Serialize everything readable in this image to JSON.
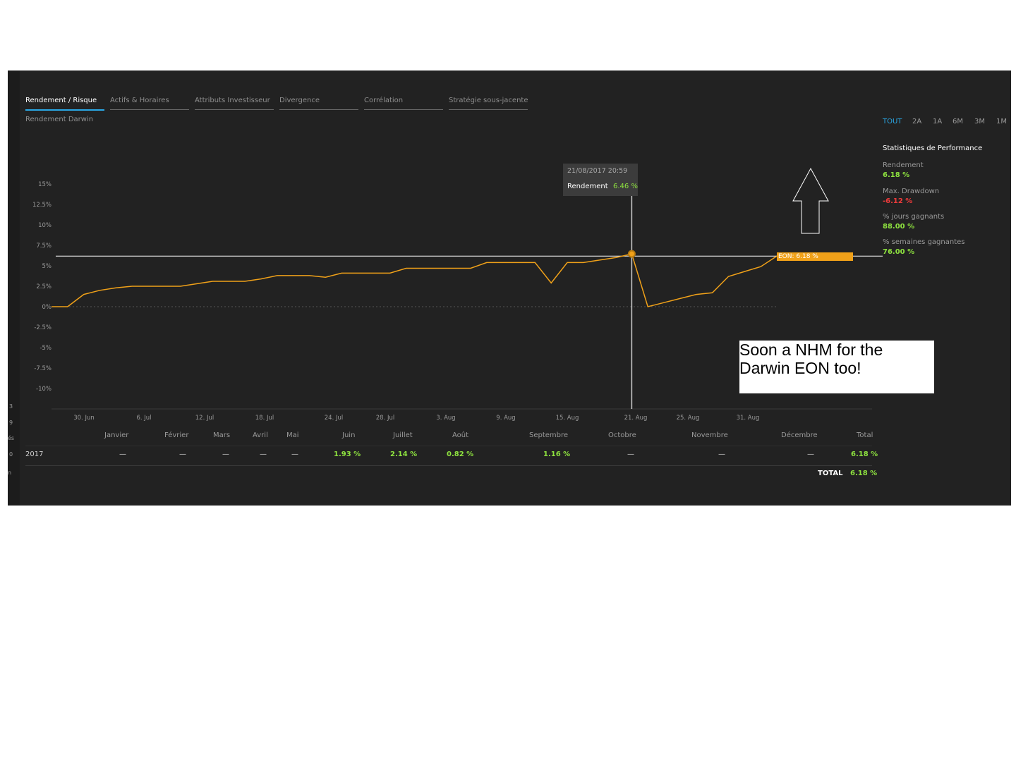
{
  "left_strip": [
    "3",
    "9",
    "és",
    "0",
    "n"
  ],
  "tabs": [
    {
      "label": "Rendement / Risque",
      "active": true
    },
    {
      "label": "Actifs & Horaires",
      "active": false
    },
    {
      "label": "Attributs Investisseur",
      "active": false
    },
    {
      "label": "Divergence",
      "active": false
    },
    {
      "label": "Corrélation",
      "active": false
    },
    {
      "label": "Stratégie sous-jacente",
      "active": false
    }
  ],
  "subtitle": "Rendement Darwin",
  "ranges": [
    {
      "label": "TOUT",
      "active": true
    },
    {
      "label": "2A",
      "active": false
    },
    {
      "label": "1A",
      "active": false
    },
    {
      "label": "6M",
      "active": false
    },
    {
      "label": "3M",
      "active": false
    },
    {
      "label": "1M",
      "active": false
    }
  ],
  "stats": {
    "title": "Statistiques de Performance",
    "items": [
      {
        "label": "Rendement",
        "value": "6.18 %",
        "tone": "green"
      },
      {
        "label": "Max. Drawdown",
        "value": "-6.12 %",
        "tone": "red"
      },
      {
        "label": "% jours gagnants",
        "value": "88.00 %",
        "tone": "green"
      },
      {
        "label": "% semaines gagnantes",
        "value": "76.00 %",
        "tone": "green"
      }
    ]
  },
  "tooltip": {
    "datetime": "21/08/2017 20:59",
    "label": "Rendement",
    "value": "6.46 %"
  },
  "eon_tag": "EON: 6.18 %",
  "colors": {
    "line": "#f0a119",
    "accent": "#2aa8e6",
    "positive": "#8ee23f",
    "negative": "#ef3b3b"
  },
  "chart_data": {
    "type": "line",
    "series": [
      {
        "name": "EON",
        "values": [
          0,
          0,
          1.5,
          2.0,
          2.3,
          2.5,
          2.5,
          2.5,
          2.5,
          2.8,
          3.1,
          3.1,
          3.1,
          3.4,
          3.8,
          3.8,
          3.8,
          3.6,
          4.1,
          4.1,
          4.1,
          4.1,
          4.7,
          4.7,
          4.7,
          4.7,
          4.7,
          5.4,
          5.4,
          5.4,
          5.4,
          2.9,
          5.4,
          5.4,
          5.7,
          6.0,
          6.46,
          0.0,
          0.5,
          1.0,
          1.5,
          1.7,
          3.7,
          4.3,
          4.9,
          6.18
        ]
      }
    ],
    "ylim": [
      -11,
      16
    ],
    "yticks": [
      "15%",
      "12.5%",
      "10%",
      "7.5%",
      "5%",
      "2.5%",
      "0%",
      "-2.5%",
      "-5%",
      "-7.5%",
      "-10%"
    ],
    "ytick_values": [
      15,
      12.5,
      10,
      7.5,
      5,
      2.5,
      0,
      -2.5,
      -5,
      -7.5,
      -10
    ],
    "xticks": [
      "30. Jun",
      "6. Jul",
      "12. Jul",
      "18. Jul",
      "24. Jul",
      "28. Jul",
      "3. Aug",
      "9. Aug",
      "15. Aug",
      "21. Aug",
      "25. Aug",
      "31. Aug"
    ],
    "reference_line": 6.18,
    "highlight": {
      "label": "21/08/2017 20:59",
      "value": 6.46
    }
  },
  "monthly": {
    "headers": [
      "Janvier",
      "Février",
      "Mars",
      "Avril",
      "Mai",
      "Juin",
      "Juillet",
      "Août",
      "Septembre",
      "Octobre",
      "Novembre",
      "Décembre",
      "Total"
    ],
    "row": {
      "year": "2017",
      "values": [
        "—",
        "—",
        "—",
        "—",
        "—",
        "1.93 %",
        "2.14 %",
        "0.82 %",
        "1.16 %",
        "—",
        "—",
        "—",
        "6.18 %"
      ]
    },
    "total_label": "TOTAL",
    "total_value": "6.18 %"
  },
  "annotation": {
    "line1": "Soon a NHM for the",
    "line2": "Darwin EON too!"
  }
}
